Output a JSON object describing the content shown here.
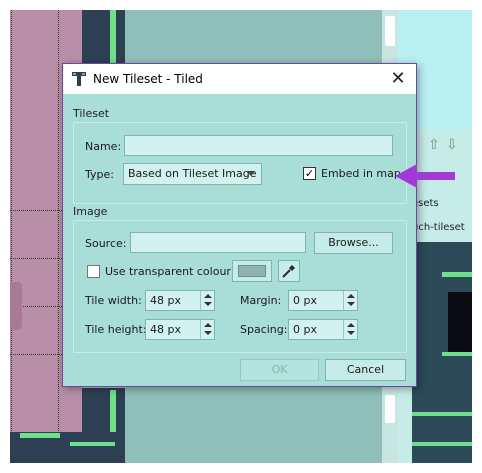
{
  "dialog": {
    "title": "New Tileset - Tiled",
    "close_glyph": "✕",
    "tileset_group": {
      "label": "Tileset",
      "name_label": "Name:",
      "name_value": "",
      "type_label": "Type:",
      "type_value": "Based on Tileset Image",
      "embed_label": "Embed in map",
      "embed_checked": true
    },
    "image_group": {
      "label": "Image",
      "source_label": "Source:",
      "source_value": "",
      "browse_label": "Browse...",
      "transparent_label": "Use transparent colour:",
      "transparent_checked": false,
      "tile_width_label": "Tile width:",
      "tile_width_value": "48 px",
      "tile_height_label": "Tile height:",
      "tile_height_value": "48 px",
      "margin_label": "Margin:",
      "margin_value": "0 px",
      "spacing_label": "Spacing:",
      "spacing_value": "0 px"
    },
    "ok_label": "OK",
    "cancel_label": "Cancel"
  },
  "background_panel": {
    "tilesets_label": "esets",
    "tileset_tab_label": "uch-tileset"
  },
  "colors": {
    "dialog_bg": "#a9ddd7",
    "dialog_border": "#6f45a8",
    "highlight_arrow": "#a43ad6",
    "tile_green": "#6fe08a",
    "tile_dark": "#2d3f52"
  },
  "icons": {
    "app": "tiled-app-icon",
    "close": "close-icon",
    "picker": "eyedropper-icon",
    "annotation": "purple-arrow-icon"
  }
}
